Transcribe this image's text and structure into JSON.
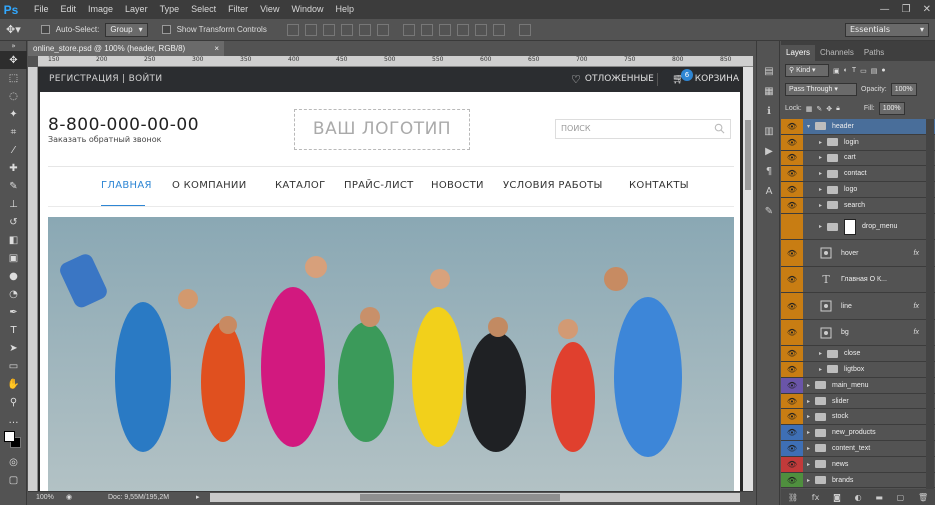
{
  "app": {
    "logo": "Ps"
  },
  "menu": [
    "File",
    "Edit",
    "Image",
    "Layer",
    "Type",
    "Select",
    "Filter",
    "View",
    "Window",
    "Help"
  ],
  "window_controls": [
    "—",
    "❐",
    "✕"
  ],
  "options": {
    "auto_select_label": "Auto-Select:",
    "auto_select_value": "Group",
    "transform_label": "Show Transform Controls",
    "workspace": "Essentials"
  },
  "document": {
    "tab_title": "online_store.psd @ 100% (header, RGB/8)",
    "close": "×"
  },
  "ruler_ticks": [
    "150",
    "200",
    "250",
    "300",
    "350",
    "400",
    "450",
    "500",
    "550",
    "600",
    "650",
    "700",
    "750",
    "800",
    "850"
  ],
  "status": {
    "zoom": "100%",
    "doc_info": "Doc: 9,55M/195,2M"
  },
  "site": {
    "top_left": "РЕГИСТРАЦИЯ | ВОЙТИ",
    "favorites": "ОТЛОЖЕННЫЕ",
    "cart_label": "КОРЗИНА",
    "cart_count": "6",
    "phone": "8-800-000-00-00",
    "callback": "Заказать обратный звонок",
    "logo": "ВАШ ЛОГОТИП",
    "search_placeholder": "ПОИСК",
    "nav": [
      "ГЛАВНАЯ",
      "О КОМПАНИИ",
      "КАТАЛОГ",
      "ПРАЙС-ЛИСТ",
      "НОВОСТИ",
      "УСЛОВИЯ РАБОТЫ",
      "КОНТАКТЫ"
    ],
    "accent": "#2e86d4"
  },
  "panel": {
    "tabs": [
      "Layers",
      "Channels",
      "Paths"
    ],
    "filter_kind": "Kind",
    "blend_mode": "Pass Through",
    "opacity_label": "Opacity:",
    "opacity_value": "100%",
    "lock_label": "Lock:",
    "fill_label": "Fill:",
    "fill_value": "100%",
    "layers": [
      {
        "name": "header",
        "color": "#c87d13",
        "indent": 0,
        "type": "group",
        "open": true,
        "selected": true
      },
      {
        "name": "login",
        "color": "#c87d13",
        "indent": 1,
        "type": "group"
      },
      {
        "name": "cart",
        "color": "#c87d13",
        "indent": 1,
        "type": "group"
      },
      {
        "name": "contact",
        "color": "#c87d13",
        "indent": 1,
        "type": "group"
      },
      {
        "name": "logo",
        "color": "#c87d13",
        "indent": 1,
        "type": "group"
      },
      {
        "name": "search",
        "color": "#c87d13",
        "indent": 1,
        "type": "group"
      },
      {
        "name": "drop_menu",
        "color": "#c87d13",
        "indent": 1,
        "type": "masked",
        "tall": true,
        "hidden": true
      },
      {
        "name": "hover",
        "color": "#c87d13",
        "indent": 1,
        "type": "shape",
        "tall": true,
        "fx": true
      },
      {
        "name": "Главная      О К...",
        "color": "#c87d13",
        "indent": 1,
        "type": "text",
        "tall": true
      },
      {
        "name": "line",
        "color": "#c87d13",
        "indent": 1,
        "type": "shape",
        "tall": true,
        "fx": true
      },
      {
        "name": "bg",
        "color": "#c87d13",
        "indent": 1,
        "type": "shape",
        "tall": true,
        "fx": true
      },
      {
        "name": "close",
        "color": "#c87d13",
        "indent": 1,
        "type": "group"
      },
      {
        "name": "ligtbox",
        "color": "#c87d13",
        "indent": 1,
        "type": "group"
      },
      {
        "name": "main_menu",
        "color": "#6a55a8",
        "indent": 0,
        "type": "group"
      },
      {
        "name": "slider",
        "color": "#c87d13",
        "indent": 0,
        "type": "group"
      },
      {
        "name": "stock",
        "color": "#c87d13",
        "indent": 0,
        "type": "group"
      },
      {
        "name": "new_products",
        "color": "#3e6fb5",
        "indent": 0,
        "type": "group"
      },
      {
        "name": "content_text",
        "color": "#3e6fb5",
        "indent": 0,
        "type": "group"
      },
      {
        "name": "news",
        "color": "#c23a3a",
        "indent": 0,
        "type": "group"
      },
      {
        "name": "brands",
        "color": "#4f8f3e",
        "indent": 0,
        "type": "group"
      }
    ],
    "bottom_icons": [
      "link-icon",
      "fx",
      "mask-icon",
      "adjustment-icon",
      "folder-icon",
      "new-layer-icon",
      "trash-icon"
    ]
  }
}
